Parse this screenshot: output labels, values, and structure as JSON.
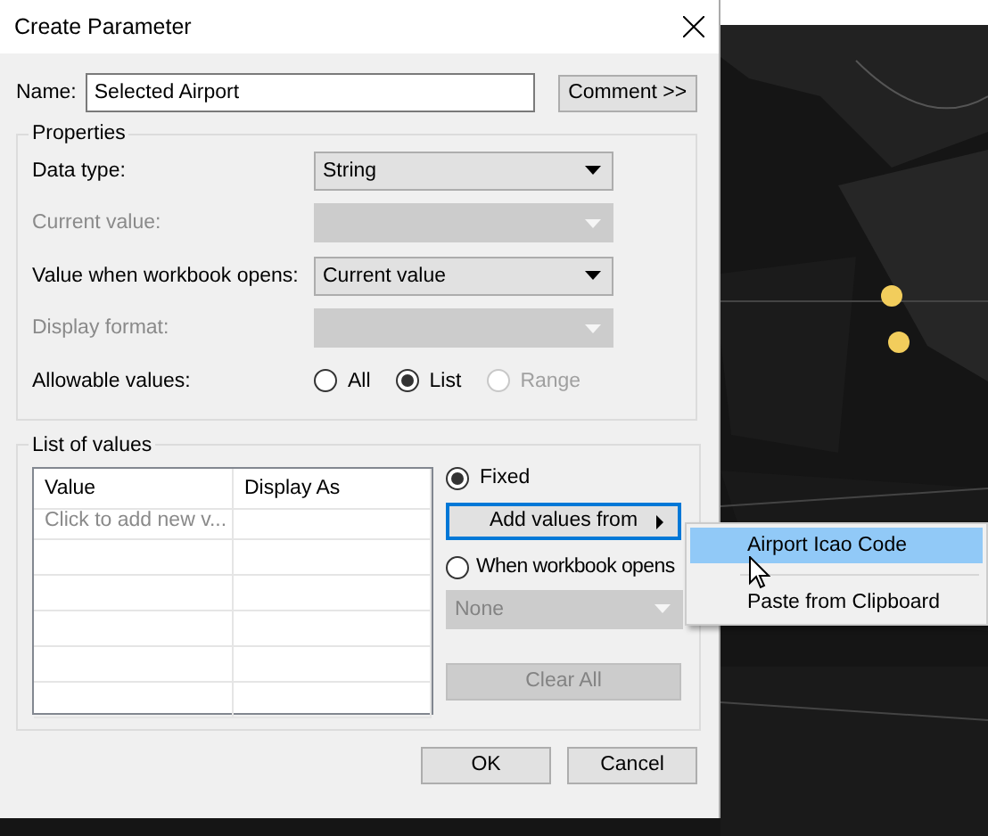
{
  "window": {
    "title": "Create Parameter"
  },
  "name": {
    "label": "Name:",
    "value": "Selected Airport"
  },
  "comment_button": "Comment >>",
  "properties": {
    "title": "Properties",
    "rows": [
      {
        "kind": "dropdown",
        "label": "Data type:",
        "value": "String",
        "disabled": false
      },
      {
        "kind": "dropdown",
        "label": "Current value:",
        "value": "",
        "disabled": true
      },
      {
        "kind": "dropdown",
        "label": "Value when workbook opens:",
        "value": "Current value",
        "disabled": false
      },
      {
        "kind": "dropdown",
        "label": "Display format:",
        "value": "",
        "disabled": true
      },
      {
        "kind": "radios",
        "label": "Allowable values:",
        "options": [
          {
            "label": "All",
            "selected": false,
            "disabled": false
          },
          {
            "label": "List",
            "selected": true,
            "disabled": false
          },
          {
            "label": "Range",
            "selected": false,
            "disabled": true
          }
        ]
      }
    ]
  },
  "list_of_values": {
    "title": "List of values",
    "table": {
      "columns": [
        "Value",
        "Display As"
      ],
      "placeholder": "Click to add new v..."
    },
    "fixed": {
      "label": "Fixed",
      "selected": true
    },
    "add_values_button": "Add values from",
    "when_opens": {
      "label": "When workbook opens",
      "selected": false
    },
    "when_opens_dropdown": {
      "value": "None",
      "disabled": true
    },
    "clear_all": {
      "label": "Clear All",
      "disabled": true
    }
  },
  "buttons": [
    "OK",
    "Cancel"
  ],
  "menu": [
    {
      "label": "Airport Icao Code",
      "selected": true
    },
    {
      "label": "Paste from Clipboard",
      "selected": false
    }
  ]
}
